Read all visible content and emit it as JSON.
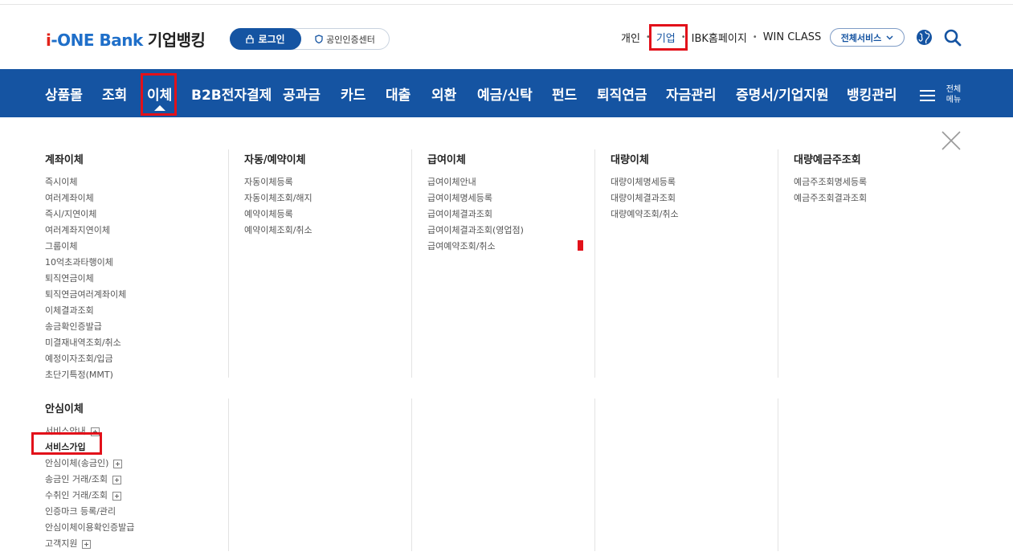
{
  "header": {
    "logo_i": "i",
    "logo_brand": "-ONE Bank",
    "logo_sub": "기업뱅킹",
    "login_label": "로그인",
    "cert_label": "공인인증센터",
    "util_links": [
      "개인",
      "기업",
      "IBK홈페이지",
      "WIN CLASS"
    ],
    "all_services_label": "전체서비스"
  },
  "nav": {
    "items": [
      "상품몰",
      "조회",
      "이체",
      "B2B전자결제",
      "공과금",
      "카드",
      "대출",
      "외환",
      "예금/신탁",
      "펀드",
      "퇴직연금",
      "자금관리",
      "증명서/기업지원",
      "뱅킹관리"
    ],
    "active": "이체",
    "full_menu_label_1": "전체",
    "full_menu_label_2": "메뉴"
  },
  "menu": {
    "account_transfer": {
      "title": "계좌이체",
      "items": [
        "즉시이체",
        "여러계좌이체",
        "즉시/지연이체",
        "여러계좌지연이체",
        "그룹이체",
        "10억초과타행이체",
        "퇴직연금이체",
        "퇴직연금여러계좌이체",
        "이체결과조회",
        "송금확인증발급",
        "미결재내역조회/취소",
        "예정이자조회/입금",
        "초단기특정(MMT)"
      ]
    },
    "auto_transfer": {
      "title": "자동/예약이체",
      "items": [
        "자동이체등록",
        "자동이체조회/해지",
        "예약이체등록",
        "예약이체조회/취소"
      ]
    },
    "salary_transfer": {
      "title": "급여이체",
      "items": [
        "급여이체안내",
        "급여이체명세등록",
        "급여이체결과조회",
        "급여이체결과조회(영업점)",
        "급여예약조회/취소"
      ]
    },
    "bulk_transfer": {
      "title": "대량이체",
      "items": [
        "대량이체명세등록",
        "대량이체결과조회",
        "대량예약조회/취소"
      ]
    },
    "bulk_deposit": {
      "title": "대량예금주조회",
      "items": [
        "예금주조회명세등록",
        "예금주조회결과조회"
      ]
    },
    "safe_transfer": {
      "title": "안심이체",
      "items": [
        "서비스안내",
        "서비스가입",
        "안심이체(송금인)",
        "송금인 거래/조회",
        "수취인 거래/조회",
        "인증마크 등록/관리",
        "안심이체이용확인증발급",
        "고객지원"
      ]
    }
  },
  "colors": {
    "brand_blue": "#1554a2",
    "highlight_red": "#e2111a"
  }
}
